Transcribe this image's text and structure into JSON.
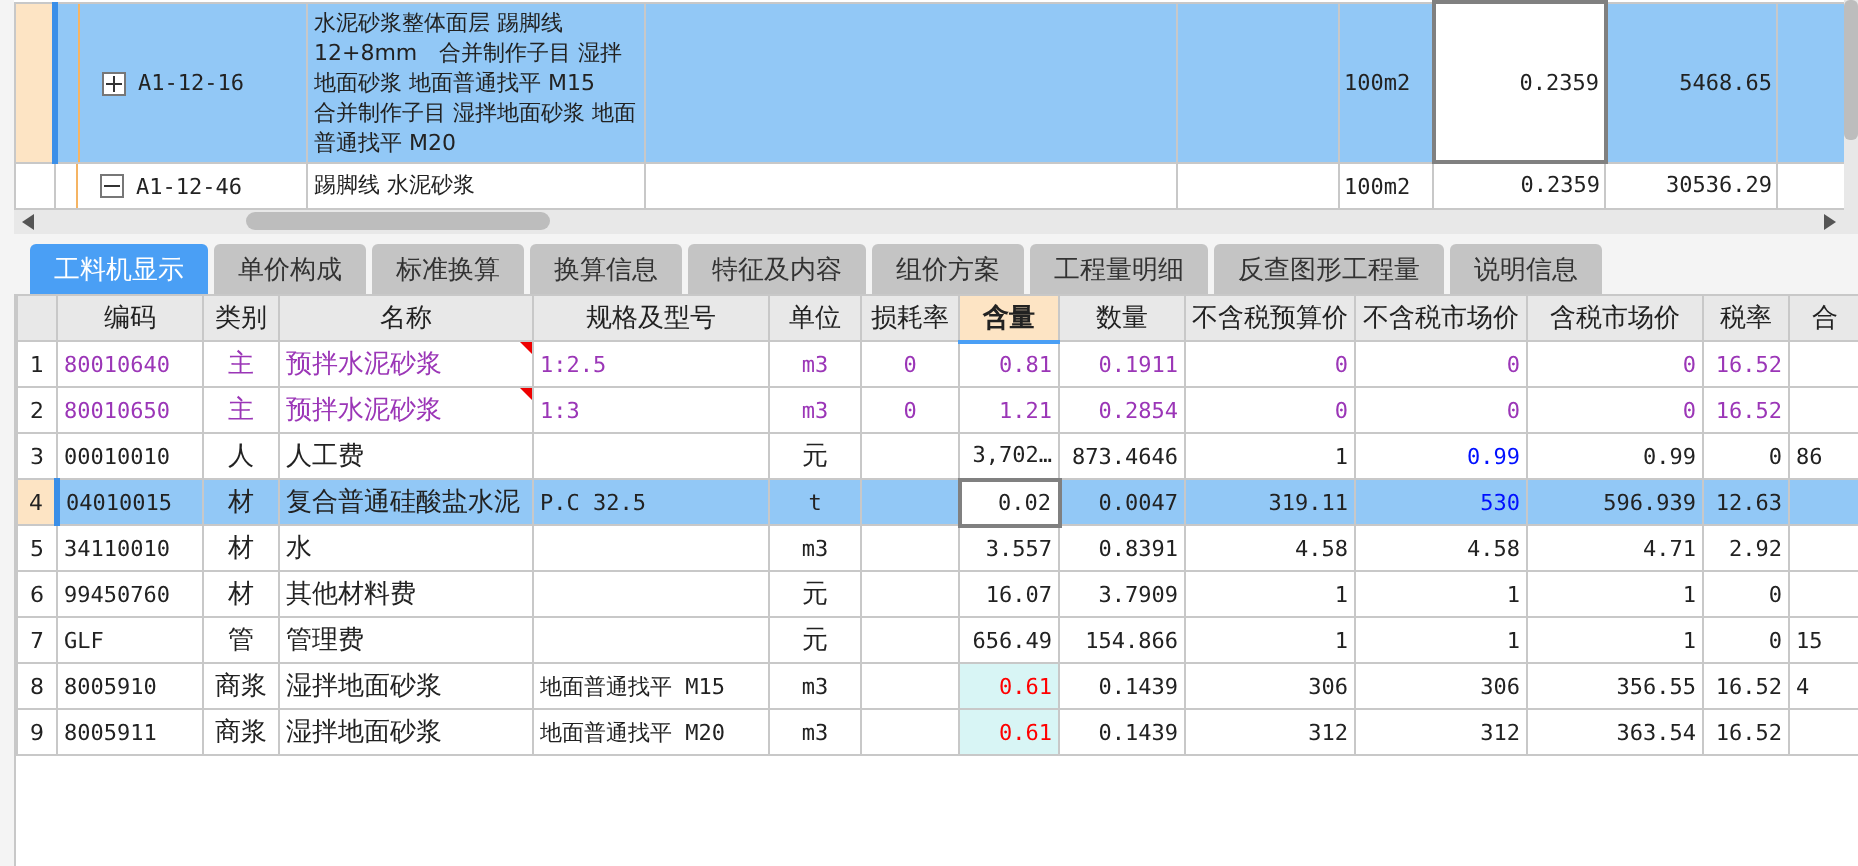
{
  "items": [
    {
      "code": "A1-12-16",
      "name": "水泥砂浆整体面层 踢脚线 12+8mm　合并制作子目 湿拌地面砂浆 地面普通找平 M15　合并制作子目 湿拌地面砂浆 地面普通找平 M20",
      "unit": "100m2",
      "quantity": "0.2359",
      "price": "5468.65",
      "expanded": false,
      "selected": true
    },
    {
      "code": "A1-12-46",
      "name": "踢脚线 水泥砂浆",
      "unit": "100m2",
      "quantity": "0.2359",
      "price": "30536.29",
      "expanded": true,
      "selected": false
    }
  ],
  "tabs": [
    {
      "label": "工料机显示",
      "selected": true
    },
    {
      "label": "单价构成",
      "selected": false
    },
    {
      "label": "标准换算",
      "selected": false
    },
    {
      "label": "换算信息",
      "selected": false
    },
    {
      "label": "特征及内容",
      "selected": false
    },
    {
      "label": "组价方案",
      "selected": false
    },
    {
      "label": "工程量明细",
      "selected": false
    },
    {
      "label": "反查图形工程量",
      "selected": false
    },
    {
      "label": "说明信息",
      "selected": false
    }
  ],
  "columns": [
    "编码",
    "类别",
    "名称",
    "规格及型号",
    "单位",
    "损耗率",
    "含量",
    "数量",
    "不含税预算价",
    "不含税市场价",
    "含税市场价",
    "税率",
    "合"
  ],
  "rows": [
    {
      "index": "1",
      "code": "80010640",
      "type": "主",
      "name": "预拌水泥砂浆",
      "spec": "1:2.5",
      "unit": "m3",
      "loss": "0",
      "content": "0.81",
      "qty": "0.1911",
      "budget": "0",
      "market": "0",
      "tax_market": "0",
      "rate": "16.52",
      "main_material": true,
      "note": true,
      "market_adjusted": false,
      "content_changed": false,
      "selected": false
    },
    {
      "index": "2",
      "code": "80010650",
      "type": "主",
      "name": "预拌水泥砂浆",
      "spec": "1:3",
      "unit": "m3",
      "loss": "0",
      "content": "1.21",
      "qty": "0.2854",
      "budget": "0",
      "market": "0",
      "tax_market": "0",
      "rate": "16.52",
      "main_material": true,
      "note": true,
      "market_adjusted": false,
      "content_changed": false,
      "selected": false
    },
    {
      "index": "3",
      "code": "00010010",
      "type": "人",
      "name": "人工费",
      "unit": "元",
      "content": "3,702…",
      "qty": "873.4646",
      "budget": "1",
      "market": "0.99",
      "tax_market": "0.99",
      "rate": "0",
      "total": "86",
      "main_material": false,
      "note": false,
      "market_adjusted": true,
      "content_changed": false,
      "selected": false
    },
    {
      "index": "4",
      "code": "04010015",
      "type": "材",
      "name": "复合普通硅酸盐水泥",
      "spec": "P.C 32.5",
      "unit": "t",
      "content": "0.02",
      "qty": "0.0047",
      "budget": "319.11",
      "market": "530",
      "tax_market": "596.939",
      "rate": "12.63",
      "main_material": false,
      "note": false,
      "market_adjusted": true,
      "content_changed": false,
      "selected": true
    },
    {
      "index": "5",
      "code": "34110010",
      "type": "材",
      "name": "水",
      "unit": "m3",
      "content": "3.557",
      "qty": "0.8391",
      "budget": "4.58",
      "market": "4.58",
      "tax_market": "4.71",
      "rate": "2.92",
      "main_material": false,
      "note": false,
      "market_adjusted": false,
      "content_changed": false,
      "selected": false
    },
    {
      "index": "6",
      "code": "99450760",
      "type": "材",
      "name": "其他材料费",
      "unit": "元",
      "content": "16.07",
      "qty": "3.7909",
      "budget": "1",
      "market": "1",
      "tax_market": "1",
      "rate": "0",
      "main_material": false,
      "note": false,
      "market_adjusted": false,
      "content_changed": false,
      "selected": false
    },
    {
      "index": "7",
      "code": "GLF",
      "type": "管",
      "name": "管理费",
      "unit": "元",
      "content": "656.49",
      "qty": "154.866",
      "budget": "1",
      "market": "1",
      "tax_market": "1",
      "rate": "0",
      "total": "15",
      "main_material": false,
      "note": false,
      "market_adjusted": false,
      "content_changed": false,
      "selected": false
    },
    {
      "index": "8",
      "code": "8005910",
      "type": "商浆",
      "name": "湿拌地面砂浆",
      "spec": "地面普通找平 M15",
      "unit": "m3",
      "content": "0.61",
      "qty": "0.1439",
      "budget": "306",
      "market": "306",
      "tax_market": "356.55",
      "rate": "16.52",
      "total": "4",
      "main_material": false,
      "note": false,
      "market_adjusted": false,
      "content_changed": true,
      "selected": false
    },
    {
      "index": "9",
      "code": "8005911",
      "type": "商浆",
      "name": "湿拌地面砂浆",
      "spec": "地面普通找平 M20",
      "unit": "m3",
      "content": "0.61",
      "qty": "0.1439",
      "budget": "312",
      "market": "312",
      "tax_market": "363.54",
      "rate": "16.52",
      "main_material": false,
      "note": false,
      "market_adjusted": false,
      "content_changed": true,
      "selected": false
    }
  ]
}
